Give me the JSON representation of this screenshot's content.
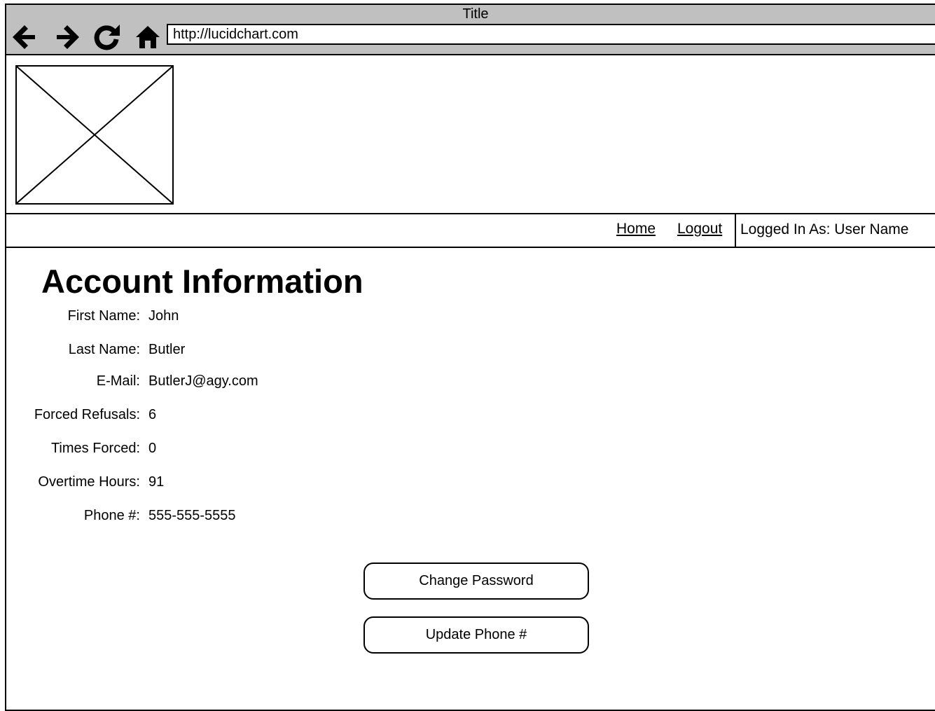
{
  "browser": {
    "title": "Title",
    "url": "http://lucidchart.com",
    "icons": [
      "back-arrow-icon",
      "forward-arrow-icon",
      "refresh-icon",
      "home-icon"
    ]
  },
  "logo": {
    "icon": "image-placeholder-icon"
  },
  "nav": {
    "home_label": "Home",
    "logout_label": "Logout",
    "logged_in_text": "Logged In As: User Name"
  },
  "page": {
    "heading": "Account Information"
  },
  "fields": {
    "first_name": {
      "label": "First Name:",
      "value": "John"
    },
    "last_name": {
      "label": "Last Name:",
      "value": "Butler"
    },
    "email": {
      "label": "E-Mail:",
      "value": "ButlerJ@agy.com"
    },
    "forced_refusals": {
      "label": "Forced Refusals:",
      "value": "6"
    },
    "times_forced": {
      "label": "Times Forced:",
      "value": "0"
    },
    "overtime_hours": {
      "label": "Overtime Hours:",
      "value": "91"
    },
    "phone": {
      "label": "Phone #:",
      "value": "555-555-5555"
    }
  },
  "actions": {
    "change_password_label": "Change Password",
    "update_phone_label": "Update Phone #"
  }
}
